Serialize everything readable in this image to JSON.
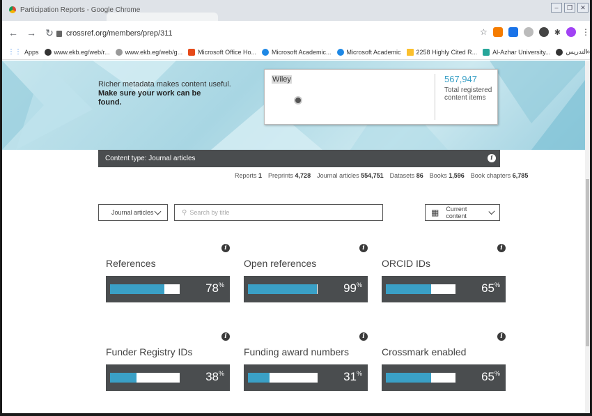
{
  "window": {
    "title": "Participation Reports - Google Chrome"
  },
  "address": {
    "url": "crossref.org/members/prep/311"
  },
  "bookmarks": [
    "Apps",
    "www.ekb.eg/web/r...",
    "www.ekb.eg/web/g...",
    "Microsoft Office Ho...",
    "Microsoft Academic...",
    "Microsoft Academic",
    "2258 Highly Cited R...",
    "Al-Azhar University...",
    "أعضاء هيئة التدريس..."
  ],
  "hero": {
    "line1": "Richer metadata makes content useful.",
    "line2": "Make sure your work can be found.",
    "member_name": "Wiley",
    "total_count": "567,947",
    "total_label": "Total registered content items"
  },
  "content_type": {
    "label": "Content type: Journal articles"
  },
  "counts": [
    {
      "label": "Reports",
      "value": "1"
    },
    {
      "label": "Preprints",
      "value": "4,728"
    },
    {
      "label": "Journal articles",
      "value": "554,751"
    },
    {
      "label": "Datasets",
      "value": "86"
    },
    {
      "label": "Books",
      "value": "1,596"
    },
    {
      "label": "Book chapters",
      "value": "6,785"
    }
  ],
  "filters": {
    "type_select": "Journal articles",
    "search_placeholder": "Search by title",
    "period_select": "Current content"
  },
  "metrics": [
    {
      "label": "References",
      "value": 78
    },
    {
      "label": "Open references",
      "value": 99
    },
    {
      "label": "ORCID IDs",
      "value": 65
    },
    {
      "label": "Funder Registry IDs",
      "value": 38
    },
    {
      "label": "Funding award numbers",
      "value": 31
    },
    {
      "label": "Crossmark enabled",
      "value": 65
    }
  ],
  "colors": {
    "accent": "#3aa0c6",
    "panel": "#4a4d4f"
  }
}
